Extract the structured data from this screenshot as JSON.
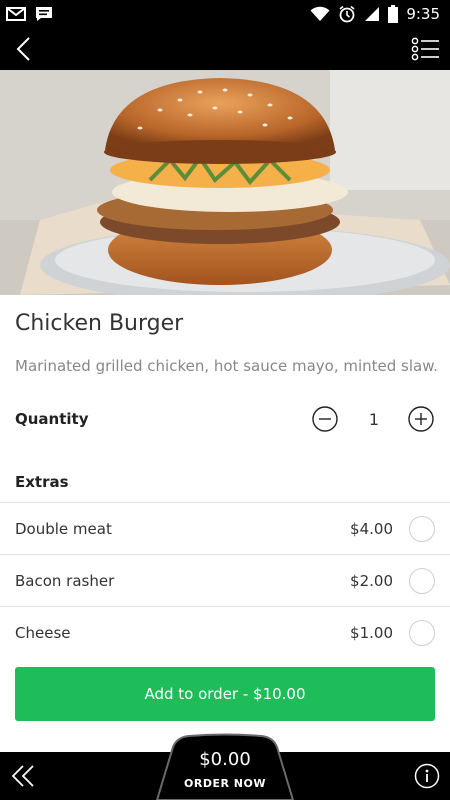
{
  "status_bar": {
    "time": "9:35",
    "left_icons": [
      "gmail-icon",
      "message-icon"
    ],
    "right_icons": [
      "wifi-icon",
      "alarm-icon",
      "signal-icon",
      "battery-icon"
    ]
  },
  "app_bar": {
    "back_icon": "chevron-left-icon",
    "menu_icon": "list-menu-icon"
  },
  "product": {
    "image": "chicken-burger-photo",
    "name": "Chicken Burger",
    "description": "Marinated grilled chicken, hot sauce mayo, minted slaw."
  },
  "quantity": {
    "label": "Quantity",
    "value": "1",
    "decrement_icon": "minus-circle-icon",
    "increment_icon": "plus-circle-icon"
  },
  "extras": {
    "title": "Extras",
    "items": [
      {
        "name": "Double meat",
        "price": "$4.00",
        "selected": false
      },
      {
        "name": "Bacon rasher",
        "price": "$2.00",
        "selected": false
      },
      {
        "name": "Cheese",
        "price": "$1.00",
        "selected": false
      }
    ]
  },
  "add_button": {
    "label": "Add to order - $10.00"
  },
  "bottom_bar": {
    "back_icon": "double-chevron-left-icon",
    "info_icon": "info-icon",
    "order_total": "$0.00",
    "order_now_label": "ORDER NOW"
  },
  "colors": {
    "accent": "#1fbd5a",
    "bar_background": "#000000"
  }
}
